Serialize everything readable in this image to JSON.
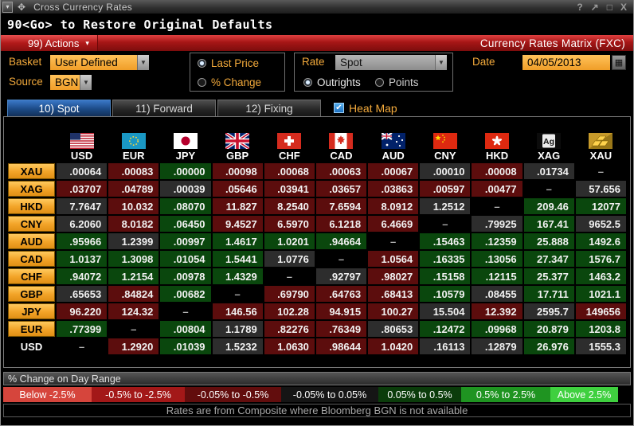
{
  "window": {
    "title": "Cross Currency Rates",
    "controls": {
      "help": "?",
      "popout": "↗",
      "maximize": "□",
      "close": "X"
    }
  },
  "icons": {
    "window_menu": "▾",
    "window_move": "✥",
    "dropdown_arrow": "▼",
    "calendar": "▦",
    "checkbox_check": "✔",
    "actions_caret": "▾"
  },
  "command_line": "90<Go> to Restore Original Defaults",
  "menu_bar": {
    "actions_label": "99) Actions",
    "screen_title": "Currency Rates Matrix (FXC)"
  },
  "toolbar": {
    "basket_label": "Basket",
    "basket_value": "User Defined",
    "source_label": "Source",
    "source_value": "BGN",
    "price_mode_options": [
      {
        "label": "Last Price",
        "selected": true
      },
      {
        "label": "% Change",
        "selected": false
      }
    ],
    "rate_label": "Rate",
    "rate_value": "Spot",
    "rate_type_options": [
      {
        "label": "Outrights",
        "selected": true
      },
      {
        "label": "Points",
        "selected": false
      }
    ],
    "date_label": "Date",
    "date_value": "04/05/2013"
  },
  "tabs": [
    {
      "label": "10) Spot",
      "active": true
    },
    {
      "label": "11) Forward",
      "active": false
    },
    {
      "label": "12) Fixing",
      "active": false
    }
  ],
  "heat_map": {
    "label": "Heat Map",
    "checked": true
  },
  "heat_colors": {
    "up": "#0a470d",
    "down": "#5c0d0d",
    "flat": "#2d2d2d",
    "none": "#000000"
  },
  "matrix": {
    "columns": [
      "USD",
      "EUR",
      "JPY",
      "GBP",
      "CHF",
      "CAD",
      "AUD",
      "CNY",
      "HKD",
      "XAG",
      "XAU"
    ],
    "rows": [
      {
        "label": "XAU",
        "cells": [
          {
            "v": ".00064",
            "s": "flat"
          },
          {
            "v": ".00083",
            "s": "down"
          },
          {
            "v": ".00000",
            "s": "up"
          },
          {
            "v": ".00098",
            "s": "down"
          },
          {
            "v": ".00068",
            "s": "down"
          },
          {
            "v": ".00063",
            "s": "down"
          },
          {
            "v": ".00067",
            "s": "down"
          },
          {
            "v": ".00010",
            "s": "flat"
          },
          {
            "v": ".00008",
            "s": "down"
          },
          {
            "v": ".01734",
            "s": "flat"
          },
          {
            "v": "–",
            "s": "none"
          }
        ]
      },
      {
        "label": "XAG",
        "cells": [
          {
            "v": ".03707",
            "s": "down"
          },
          {
            "v": ".04789",
            "s": "down"
          },
          {
            "v": ".00039",
            "s": "flat"
          },
          {
            "v": ".05646",
            "s": "down"
          },
          {
            "v": ".03941",
            "s": "down"
          },
          {
            "v": ".03657",
            "s": "down"
          },
          {
            "v": ".03863",
            "s": "down"
          },
          {
            "v": ".00597",
            "s": "down"
          },
          {
            "v": ".00477",
            "s": "down"
          },
          {
            "v": "–",
            "s": "none"
          },
          {
            "v": "57.656",
            "s": "flat"
          }
        ]
      },
      {
        "label": "HKD",
        "cells": [
          {
            "v": "7.7647",
            "s": "flat"
          },
          {
            "v": "10.032",
            "s": "down"
          },
          {
            "v": ".08070",
            "s": "up"
          },
          {
            "v": "11.827",
            "s": "down"
          },
          {
            "v": "8.2540",
            "s": "down"
          },
          {
            "v": "7.6594",
            "s": "down"
          },
          {
            "v": "8.0912",
            "s": "down"
          },
          {
            "v": "1.2512",
            "s": "flat"
          },
          {
            "v": "–",
            "s": "none"
          },
          {
            "v": "209.46",
            "s": "up"
          },
          {
            "v": "12077",
            "s": "up"
          }
        ]
      },
      {
        "label": "CNY",
        "cells": [
          {
            "v": "6.2060",
            "s": "flat"
          },
          {
            "v": "8.0182",
            "s": "down"
          },
          {
            "v": ".06450",
            "s": "up"
          },
          {
            "v": "9.4527",
            "s": "down"
          },
          {
            "v": "6.5970",
            "s": "down"
          },
          {
            "v": "6.1218",
            "s": "down"
          },
          {
            "v": "6.4669",
            "s": "down"
          },
          {
            "v": "–",
            "s": "none"
          },
          {
            "v": ".79925",
            "s": "flat"
          },
          {
            "v": "167.41",
            "s": "up"
          },
          {
            "v": "9652.5",
            "s": "flat"
          }
        ]
      },
      {
        "label": "AUD",
        "cells": [
          {
            "v": ".95966",
            "s": "up"
          },
          {
            "v": "1.2399",
            "s": "flat"
          },
          {
            "v": ".00997",
            "s": "up"
          },
          {
            "v": "1.4617",
            "s": "up"
          },
          {
            "v": "1.0201",
            "s": "up"
          },
          {
            "v": ".94664",
            "s": "up"
          },
          {
            "v": "–",
            "s": "none"
          },
          {
            "v": ".15463",
            "s": "up"
          },
          {
            "v": ".12359",
            "s": "up"
          },
          {
            "v": "25.888",
            "s": "up"
          },
          {
            "v": "1492.6",
            "s": "up"
          }
        ]
      },
      {
        "label": "CAD",
        "cells": [
          {
            "v": "1.0137",
            "s": "up"
          },
          {
            "v": "1.3098",
            "s": "up"
          },
          {
            "v": ".01054",
            "s": "up"
          },
          {
            "v": "1.5441",
            "s": "up"
          },
          {
            "v": "1.0776",
            "s": "flat"
          },
          {
            "v": "–",
            "s": "none"
          },
          {
            "v": "1.0564",
            "s": "down"
          },
          {
            "v": ".16335",
            "s": "up"
          },
          {
            "v": ".13056",
            "s": "up"
          },
          {
            "v": "27.347",
            "s": "up"
          },
          {
            "v": "1576.7",
            "s": "up"
          }
        ]
      },
      {
        "label": "CHF",
        "cells": [
          {
            "v": ".94072",
            "s": "up"
          },
          {
            "v": "1.2154",
            "s": "up"
          },
          {
            "v": ".00978",
            "s": "up"
          },
          {
            "v": "1.4329",
            "s": "up"
          },
          {
            "v": "–",
            "s": "none"
          },
          {
            "v": ".92797",
            "s": "flat"
          },
          {
            "v": ".98027",
            "s": "down"
          },
          {
            "v": ".15158",
            "s": "up"
          },
          {
            "v": ".12115",
            "s": "up"
          },
          {
            "v": "25.377",
            "s": "up"
          },
          {
            "v": "1463.2",
            "s": "up"
          }
        ]
      },
      {
        "label": "GBP",
        "cells": [
          {
            "v": ".65653",
            "s": "flat"
          },
          {
            "v": ".84824",
            "s": "down"
          },
          {
            "v": ".00682",
            "s": "up"
          },
          {
            "v": "–",
            "s": "none"
          },
          {
            "v": ".69790",
            "s": "down"
          },
          {
            "v": ".64763",
            "s": "down"
          },
          {
            "v": ".68413",
            "s": "down"
          },
          {
            "v": ".10579",
            "s": "up"
          },
          {
            "v": ".08455",
            "s": "flat"
          },
          {
            "v": "17.711",
            "s": "up"
          },
          {
            "v": "1021.1",
            "s": "up"
          }
        ]
      },
      {
        "label": "JPY",
        "cells": [
          {
            "v": "96.220",
            "s": "down"
          },
          {
            "v": "124.32",
            "s": "down"
          },
          {
            "v": "–",
            "s": "none"
          },
          {
            "v": "146.56",
            "s": "down"
          },
          {
            "v": "102.28",
            "s": "down"
          },
          {
            "v": "94.915",
            "s": "down"
          },
          {
            "v": "100.27",
            "s": "down"
          },
          {
            "v": "15.504",
            "s": "flat"
          },
          {
            "v": "12.392",
            "s": "down"
          },
          {
            "v": "2595.7",
            "s": "flat"
          },
          {
            "v": "149656",
            "s": "down"
          }
        ]
      },
      {
        "label": "EUR",
        "cells": [
          {
            "v": ".77399",
            "s": "up"
          },
          {
            "v": "–",
            "s": "none"
          },
          {
            "v": ".00804",
            "s": "up"
          },
          {
            "v": "1.1789",
            "s": "flat"
          },
          {
            "v": ".82276",
            "s": "down"
          },
          {
            "v": ".76349",
            "s": "down"
          },
          {
            "v": ".80653",
            "s": "flat"
          },
          {
            "v": ".12472",
            "s": "up"
          },
          {
            "v": ".09968",
            "s": "up"
          },
          {
            "v": "20.879",
            "s": "up"
          },
          {
            "v": "1203.8",
            "s": "up"
          }
        ]
      },
      {
        "label": "USD",
        "plain": true,
        "cells": [
          {
            "v": "–",
            "s": "none"
          },
          {
            "v": "1.2920",
            "s": "down"
          },
          {
            "v": ".01039",
            "s": "up"
          },
          {
            "v": "1.5232",
            "s": "flat"
          },
          {
            "v": "1.0630",
            "s": "down"
          },
          {
            "v": ".98644",
            "s": "down"
          },
          {
            "v": "1.0420",
            "s": "down"
          },
          {
            "v": ".16113",
            "s": "flat"
          },
          {
            "v": ".12879",
            "s": "flat"
          },
          {
            "v": "26.976",
            "s": "up"
          },
          {
            "v": "1555.3",
            "s": "flat"
          }
        ]
      }
    ]
  },
  "legend": {
    "title": "% Change on Day Range",
    "ranges": [
      {
        "label": "Below -2.5%",
        "color": "#d6453c"
      },
      {
        "label": "-0.5% to -2.5%",
        "color": "#a31818"
      },
      {
        "label": "-0.05% to -0.5%",
        "color": "#620d0d"
      },
      {
        "label": "-0.05% to 0.05%",
        "color": "#151515"
      },
      {
        "label": "0.05% to 0.5%",
        "color": "#0b3c0b"
      },
      {
        "label": "0.5% to 2.5%",
        "color": "#1f9421"
      },
      {
        "label": "Above 2.5%",
        "color": "#3fd03f"
      }
    ]
  },
  "footer": "Rates are from Composite where Bloomberg BGN is not available"
}
